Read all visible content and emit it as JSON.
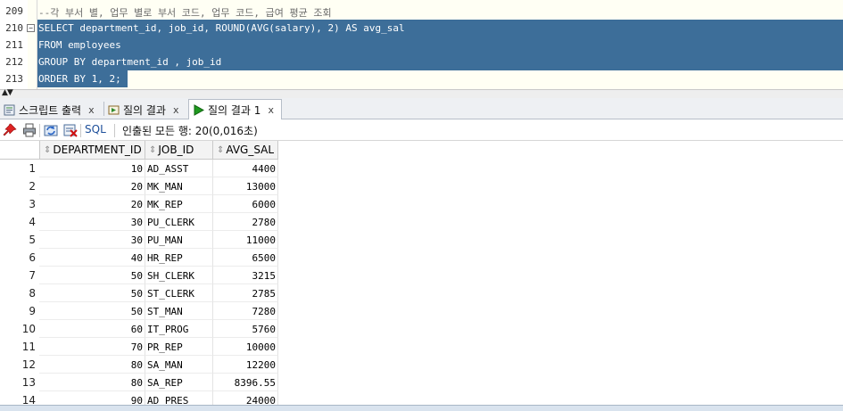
{
  "editor": {
    "lines": [
      {
        "num": "209",
        "text": "--각 부서 별, 업무 별로 부서 코드, 업무 코드, 급여 평균 조회"
      },
      {
        "num": "210",
        "text": "SELECT department_id, job_id, ROUND(AVG(salary), 2) AS avg_sal"
      },
      {
        "num": "211",
        "text": "FROM employees"
      },
      {
        "num": "212",
        "text": "GROUP BY department_id , job_id"
      },
      {
        "num": "213",
        "text": "ORDER BY 1, 2;"
      }
    ],
    "fold_marker": "−",
    "selection_color": "#3d6e99"
  },
  "tabs": [
    {
      "label": "스크립트 출력",
      "close": "x",
      "icon": "script-output-icon"
    },
    {
      "label": "질의 결과",
      "close": "x",
      "icon": "query-result-icon"
    },
    {
      "label": "질의 결과 1",
      "close": "x",
      "icon": "run-triangle-icon",
      "active": true
    }
  ],
  "toolbar": {
    "sql_label": "SQL",
    "status": "인출된 모든 행: 20(0,016초)",
    "icons": [
      "pin-icon",
      "print-icon",
      "refresh-icon",
      "clear-icon"
    ]
  },
  "grid": {
    "columns": [
      "DEPARTMENT_ID",
      "JOB_ID",
      "AVG_SAL"
    ],
    "rows": [
      {
        "n": "1",
        "dept": "10",
        "job": "AD_ASST",
        "sal": "4400"
      },
      {
        "n": "2",
        "dept": "20",
        "job": "MK_MAN",
        "sal": "13000"
      },
      {
        "n": "3",
        "dept": "20",
        "job": "MK_REP",
        "sal": "6000"
      },
      {
        "n": "4",
        "dept": "30",
        "job": "PU_CLERK",
        "sal": "2780"
      },
      {
        "n": "5",
        "dept": "30",
        "job": "PU_MAN",
        "sal": "11000"
      },
      {
        "n": "6",
        "dept": "40",
        "job": "HR_REP",
        "sal": "6500"
      },
      {
        "n": "7",
        "dept": "50",
        "job": "SH_CLERK",
        "sal": "3215"
      },
      {
        "n": "8",
        "dept": "50",
        "job": "ST_CLERK",
        "sal": "2785"
      },
      {
        "n": "9",
        "dept": "50",
        "job": "ST_MAN",
        "sal": "7280"
      },
      {
        "n": "10",
        "dept": "60",
        "job": "IT_PROG",
        "sal": "5760"
      },
      {
        "n": "11",
        "dept": "70",
        "job": "PR_REP",
        "sal": "10000"
      },
      {
        "n": "12",
        "dept": "80",
        "job": "SA_MAN",
        "sal": "12200"
      },
      {
        "n": "13",
        "dept": "80",
        "job": "SA_REP",
        "sal": "8396.55"
      },
      {
        "n": "14",
        "dept": "90",
        "job": "AD_PRES",
        "sal": "24000"
      }
    ]
  }
}
